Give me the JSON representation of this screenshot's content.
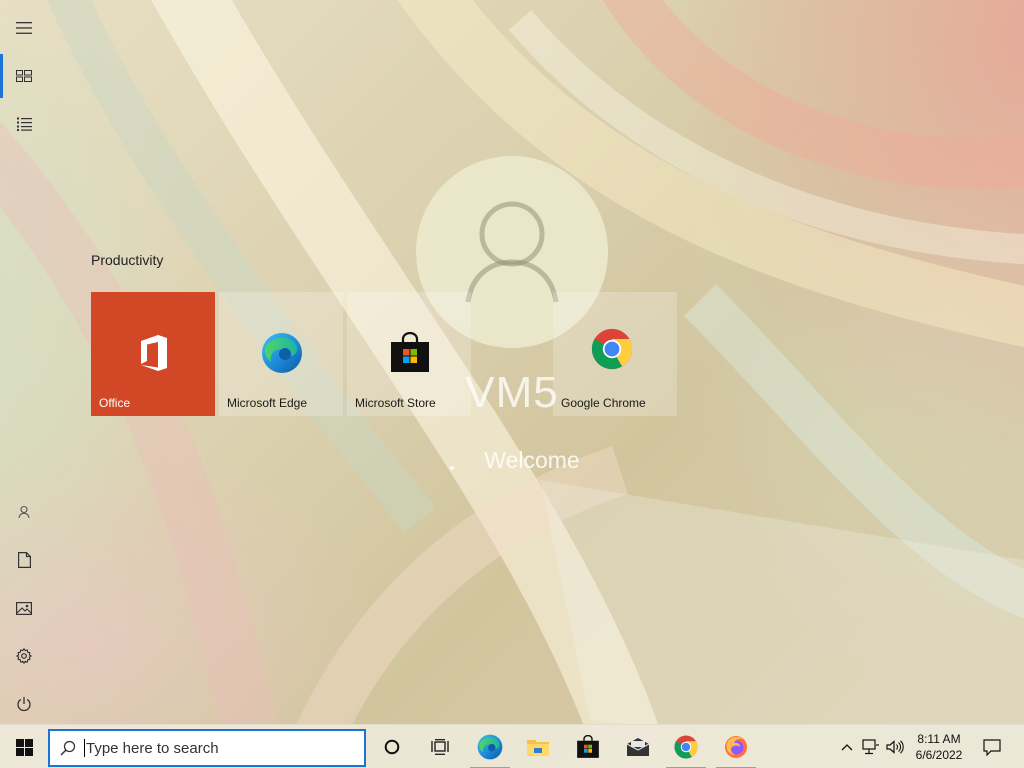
{
  "lock_screen": {
    "account_name": "VM5",
    "status": "Welcome"
  },
  "start_menu": {
    "rail": [
      {
        "icon": "hamburger-menu-icon"
      },
      {
        "icon": "pinned-tiles-icon",
        "active": true
      },
      {
        "icon": "all-apps-list-icon"
      },
      {
        "icon": "user-account-icon"
      },
      {
        "icon": "documents-icon"
      },
      {
        "icon": "pictures-icon"
      },
      {
        "icon": "settings-gear-icon"
      },
      {
        "icon": "power-icon"
      }
    ],
    "group_title": "Productivity",
    "tiles": [
      {
        "label": "Office",
        "icon": "office-logo-icon",
        "color": "#d24726"
      },
      {
        "label": "Microsoft Edge",
        "icon": "edge-logo-icon"
      },
      {
        "label": "Microsoft Store",
        "icon": "store-bag-icon"
      },
      {
        "label": "Google Chrome",
        "icon": "chrome-logo-icon"
      }
    ]
  },
  "taskbar": {
    "search_placeholder": "Type here to search",
    "apps": [
      {
        "name": "Microsoft Edge",
        "icon": "edge-logo-icon",
        "running": true
      },
      {
        "name": "File Explorer",
        "icon": "file-explorer-icon",
        "running": false
      },
      {
        "name": "Microsoft Store",
        "icon": "store-bag-icon",
        "running": false
      },
      {
        "name": "Mail",
        "icon": "mail-icon",
        "running": false
      },
      {
        "name": "Google Chrome",
        "icon": "chrome-logo-icon",
        "running": true
      },
      {
        "name": "Firefox",
        "icon": "firefox-logo-icon",
        "running": true
      }
    ],
    "clock": {
      "time": "8:11 AM",
      "date": "6/6/2022"
    }
  },
  "colors": {
    "accent": "#1a73d9",
    "office_tile": "#d24726"
  }
}
